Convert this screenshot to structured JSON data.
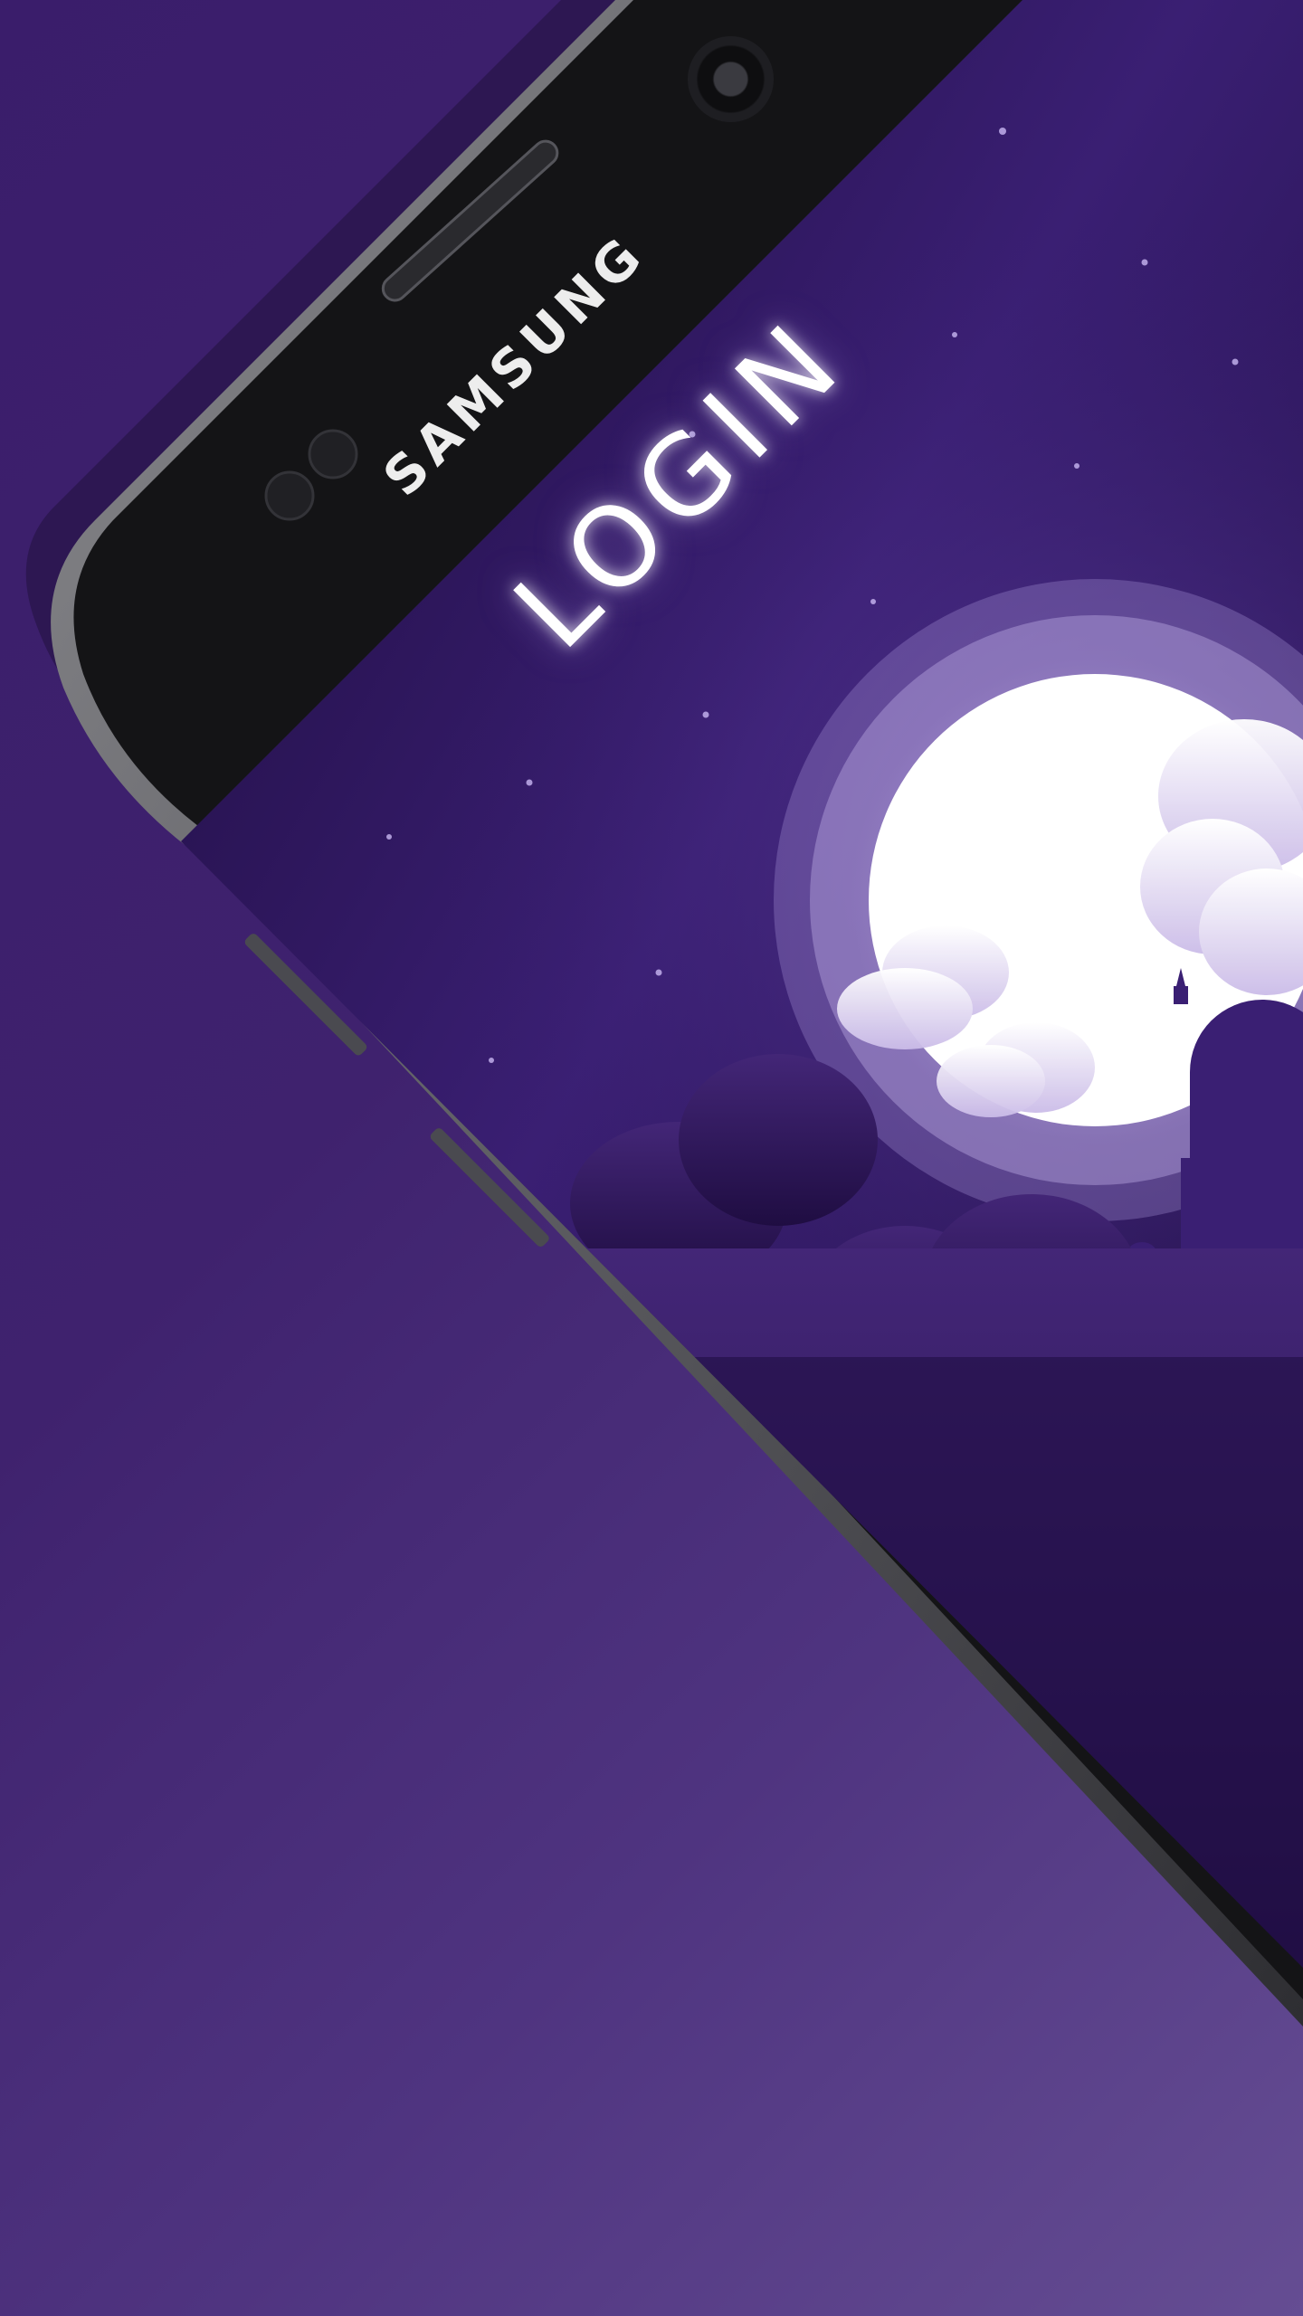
{
  "device": {
    "brand": "SAMSUNG"
  },
  "screen": {
    "title": "LOGIN"
  },
  "colors": {
    "background": "#3f226e",
    "screen_dark": "#1b0a3a",
    "accent_purple": "#4a2a8a",
    "moon_glow": "#ffffff"
  }
}
